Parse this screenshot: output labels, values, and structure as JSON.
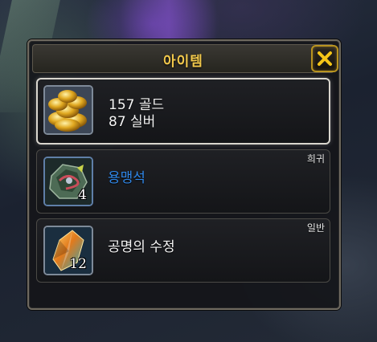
{
  "window": {
    "title": "아이템",
    "close_icon": "close-x-icon",
    "accent_color": "#f2c94c"
  },
  "items": [
    {
      "icon": "gold-coins-icon",
      "lines": [
        "157 골드",
        "87 실버"
      ],
      "selected": true
    },
    {
      "icon": "dragonstone-icon",
      "name": "용맹석",
      "grade": "희귀",
      "grade_color": "#2f86e6",
      "quantity": "4"
    },
    {
      "icon": "crystal-icon",
      "name": "공명의 수정",
      "grade": "일반",
      "quantity": "12"
    }
  ]
}
